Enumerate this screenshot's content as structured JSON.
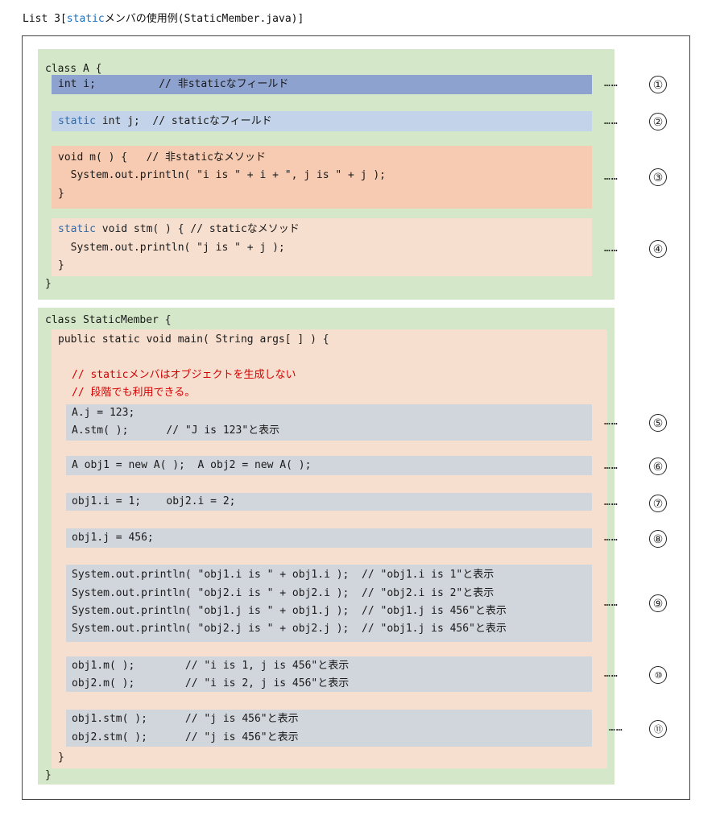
{
  "caption": {
    "prefix": "List 3[",
    "keyword": "static",
    "suffix": "メンバの使用例(StaticMember.java)]"
  },
  "class_a": {
    "open": "class A {",
    "field_i": "int i;          // 非staticなフィールド",
    "field_j_kw": "static",
    "field_j_rest": " int j;  // staticなフィールド",
    "method_m": [
      "void m( ) {   // 非staticなメソッド",
      "  System.out.println( \"i is \" + i + \", j is \" + j );",
      "}"
    ],
    "stm_kw": "static",
    "stm_rest": " void stm( ) { // staticなメソッド",
    "stm_body": [
      "  System.out.println( \"j is \" + j );",
      "}"
    ],
    "close": "}"
  },
  "class_main": {
    "open": "class StaticMember {",
    "main_sig": "public static void main( String args[ ] ) {",
    "comment1": "// staticメンバはオブジェクトを生成しない",
    "comment2": "// 段階でも利用できる。",
    "b5": [
      "A.j = 123;",
      "A.stm( );      // \"J is 123\"と表示"
    ],
    "b6": "A obj1 = new A( );  A obj2 = new A( );",
    "b7": "obj1.i = 1;    obj2.i = 2;",
    "b8": "obj1.j = 456;",
    "b9": [
      "System.out.println( \"obj1.i is \" + obj1.i );  // \"obj1.i is 1\"と表示",
      "System.out.println( \"obj2.i is \" + obj2.i );  // \"obj2.i is 2\"と表示",
      "System.out.println( \"obj1.j is \" + obj1.j );  // \"obj1.j is 456\"と表示",
      "System.out.println( \"obj2.j is \" + obj2.j );  // \"obj1.j is 456\"と表示"
    ],
    "b10": [
      "obj1.m( );        // \"i is 1, j is 456\"と表示",
      "obj2.m( );        // \"i is 2, j is 456\"と表示"
    ],
    "b11": [
      "obj1.stm( );      // \"j is 456\"と表示",
      "obj2.stm( );      // \"j is 456\"と表示"
    ],
    "close_main": "}",
    "close": "}"
  },
  "markers": {
    "dots": "……",
    "n1": "①",
    "n2": "②",
    "n3": "③",
    "n4": "④",
    "n5": "⑤",
    "n6": "⑥",
    "n7": "⑦",
    "n8": "⑧",
    "n9": "⑨",
    "n10": "⑩",
    "n11": "⑪"
  },
  "colors": {
    "keyword": "#2b6cb0",
    "comment_red": "#d40000",
    "green_bg": "#d4e8c9",
    "field_i_bg": "#8ea2cf",
    "field_j_bg": "#c3d3ea",
    "method_m_bg": "#f6cbb2",
    "stm_bg": "#f7dfcf",
    "statement_bg": "#d1d5dc"
  }
}
